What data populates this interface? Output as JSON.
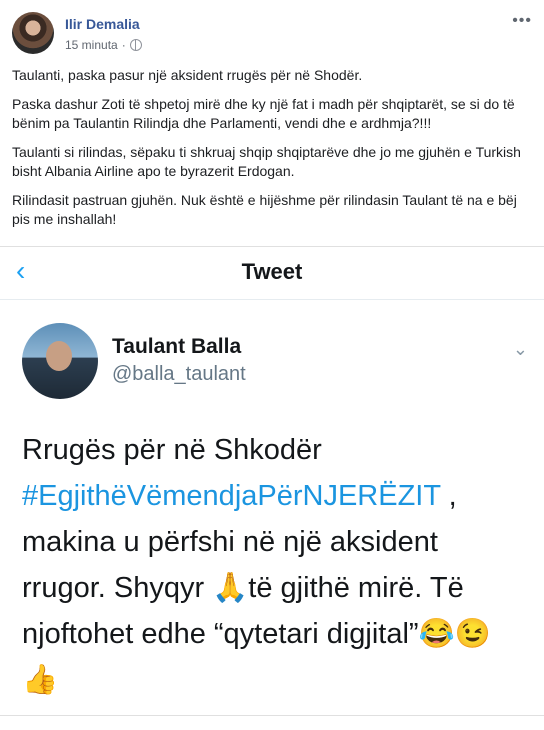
{
  "post": {
    "author": "Ilir Demalia",
    "time": "15 minuta",
    "more_icon": "•••",
    "paragraphs": [
      "Taulanti, paska pasur një aksident rrugës për në Shodër.",
      "Paska dashur Zoti të shpetoj mirë dhe ky një fat i madh për shqiptarët, se si do të bënim pa Taulantin Rilindja dhe Parlamenti, vendi dhe e ardhmja?!!!",
      "Taulanti si rilindas, sëpaku ti shkruaj shqip shqiptarëve dhe jo me gjuhën e Turkish bisht Albania Airline apo te byrazerit Erdogan.",
      "Rilindasit pastruan gjuhën. Nuk është e hijëshme për rilindasin Taulant të na e bëj pis me inshallah!"
    ]
  },
  "tweet": {
    "header_title": "Tweet",
    "back_icon": "‹",
    "name": "Taulant Balla",
    "handle": "@balla_taulant",
    "chevron_icon": "⌄",
    "text_pre": "Rrugës për në Shkodër ",
    "hashtag": "#EgjithëVëmendjaPërNJERËZIT",
    "text_post": " , makina u përfshi në një aksident rrugor. Shyqyr 🙏të gjithë mirë. Të njoftohet edhe “qytetari digjital”😂😉 👍"
  }
}
